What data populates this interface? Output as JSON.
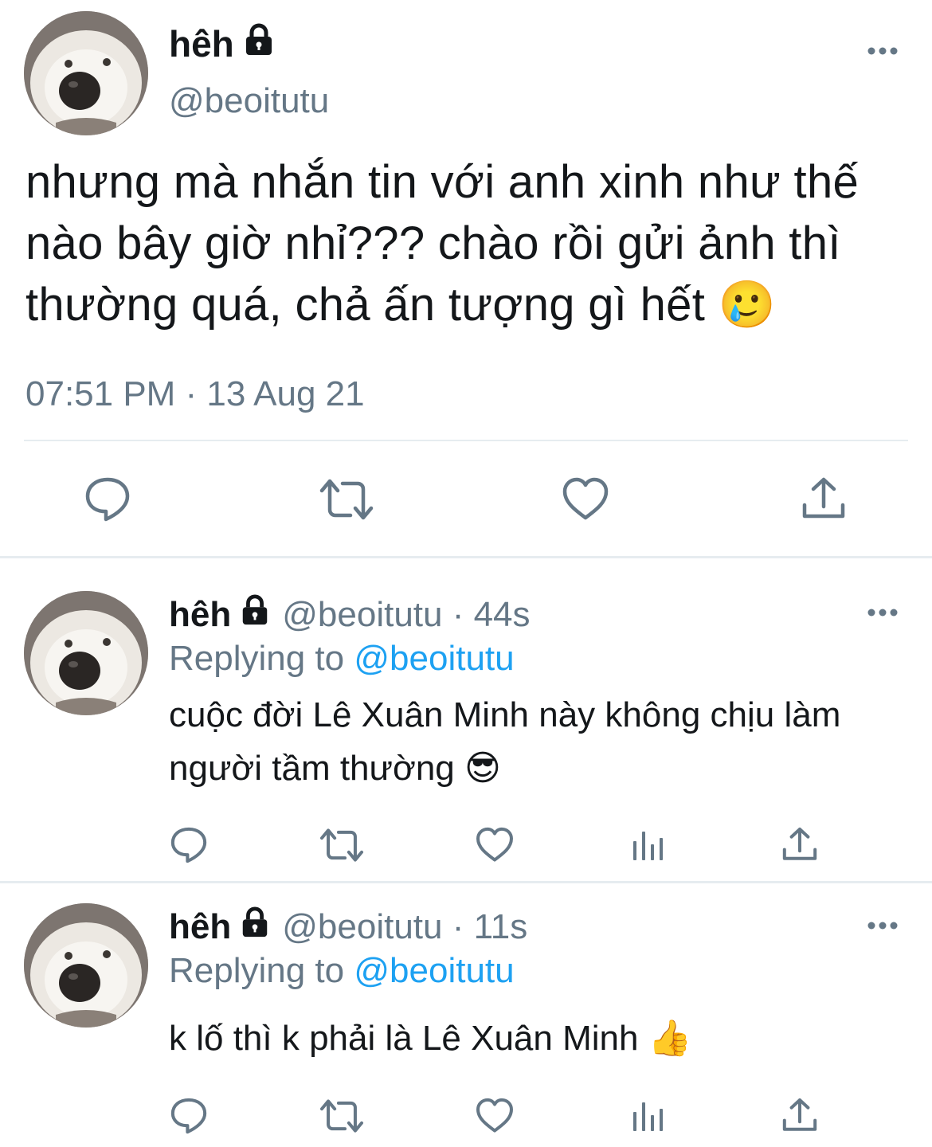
{
  "main_tweet": {
    "display_name": "hêh",
    "handle": "@beoitutu",
    "text": "nhưng mà nhắn tin với anh xinh như thế nào bây giờ nhỉ??? chào rồi gửi ảnh thì thường quá, chả ấn tượng gì hết 🥲",
    "timestamp": "07:51 PM · 13 Aug 21",
    "icons": [
      "comment-icon",
      "retweet-icon",
      "like-icon",
      "share-icon",
      "more-icon",
      "lock-icon"
    ]
  },
  "replies": [
    {
      "display_name": "hêh",
      "meta": "@beoitutu · 44s",
      "replying_prefix": "Replying to",
      "replying_mention": "@beoitutu",
      "text": "cuộc đời Lê Xuân Minh này không chịu làm người tầm thường 😎"
    },
    {
      "display_name": "hêh",
      "meta": "@beoitutu · 11s",
      "replying_prefix": "Replying to",
      "replying_mention": "@beoitutu",
      "text": "k lố thì k phải là Lê Xuân Minh 👍"
    }
  ],
  "colors": {
    "text": "#14171a",
    "secondary": "#657786",
    "link": "#1da1f2",
    "divider": "#e6ecf0"
  }
}
